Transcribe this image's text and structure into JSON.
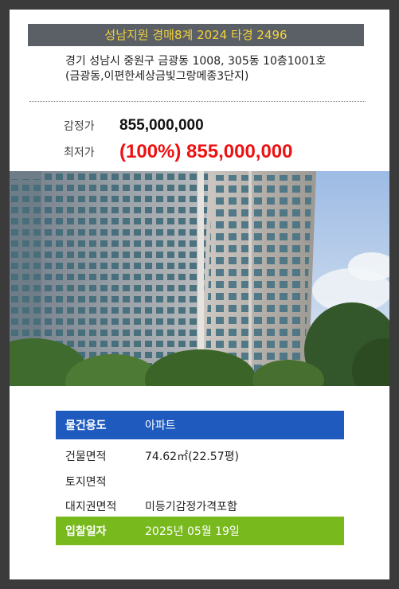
{
  "header": {
    "title": "성남지원 경매8계 2024 타경 2496"
  },
  "address": {
    "text": "경기 성남시 중원구 금광동 1008, 305동 10층1001호 (금광동,이편한세상금빛그랑메종3단지)"
  },
  "prices": {
    "appraisal_label": "감정가",
    "appraisal_value": "855,000,000",
    "minimum_label": "최저가",
    "minimum_value": "(100%) 855,000,000"
  },
  "photo": {
    "icon": "apartment-building-photo"
  },
  "info": {
    "usage_label": "물건용도",
    "usage_value": "아파트",
    "building_area_label": "건물면적",
    "building_area_value": "74.62㎡(22.57평)",
    "land_area_label": "토지면적",
    "land_area_value": "",
    "land_rights_label": "대지권면적",
    "land_rights_value": "미등기감정가격포함",
    "bid_date_label": "입찰일자",
    "bid_date_value": "2025년 05월 19일"
  },
  "colors": {
    "title_bg": "#5b6066",
    "title_text": "#f2d23a",
    "min_price": "#ee1111",
    "usage_bg": "#1f5bbf",
    "date_bg": "#78b91e"
  }
}
